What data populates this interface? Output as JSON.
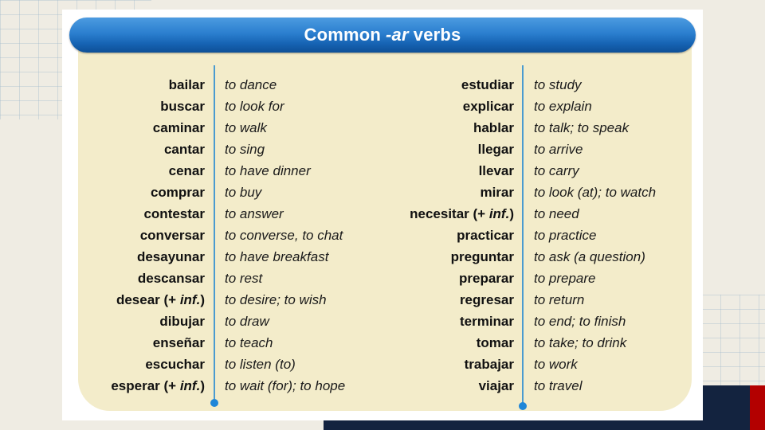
{
  "title": {
    "prefix": "Common",
    "emphasis": "-ar",
    "suffix": "verbs"
  },
  "colors": {
    "title_bar": "#2b7fcf",
    "panel": "#f3ecca",
    "divider": "#4a9bd0",
    "navy_accent": "#13233f",
    "red_accent": "#b30000"
  },
  "left_column": [
    {
      "verb": "bailar",
      "note": "",
      "meaning": "to dance"
    },
    {
      "verb": "buscar",
      "note": "",
      "meaning": "to look for"
    },
    {
      "verb": "caminar",
      "note": "",
      "meaning": "to walk"
    },
    {
      "verb": "cantar",
      "note": "",
      "meaning": "to sing"
    },
    {
      "verb": "cenar",
      "note": "",
      "meaning": "to have dinner"
    },
    {
      "verb": "comprar",
      "note": "",
      "meaning": "to buy"
    },
    {
      "verb": "contestar",
      "note": "",
      "meaning": "to answer"
    },
    {
      "verb": "conversar",
      "note": "",
      "meaning": "to converse, to chat"
    },
    {
      "verb": "desayunar",
      "note": "",
      "meaning": "to have breakfast"
    },
    {
      "verb": "descansar",
      "note": "",
      "meaning": "to rest"
    },
    {
      "verb": "desear (+ ",
      "note": "inf.",
      "close": ")",
      "meaning": "to desire; to wish"
    },
    {
      "verb": "dibujar",
      "note": "",
      "meaning": "to draw"
    },
    {
      "verb": "enseñar",
      "note": "",
      "meaning": "to teach"
    },
    {
      "verb": "escuchar",
      "note": "",
      "meaning": "to listen (to)"
    },
    {
      "verb": "esperar (+ ",
      "note": "inf.",
      "close": ")",
      "meaning": "to wait (for); to hope"
    }
  ],
  "right_column": [
    {
      "verb": "estudiar",
      "note": "",
      "meaning": "to study"
    },
    {
      "verb": "explicar",
      "note": "",
      "meaning": "to explain"
    },
    {
      "verb": "hablar",
      "note": "",
      "meaning": "to talk; to speak"
    },
    {
      "verb": "llegar",
      "note": "",
      "meaning": "to arrive"
    },
    {
      "verb": "llevar",
      "note": "",
      "meaning": "to carry"
    },
    {
      "verb": "mirar",
      "note": "",
      "meaning": "to look (at); to watch"
    },
    {
      "verb": "necesitar (+ ",
      "note": "inf.",
      "close": ")",
      "meaning": "to need"
    },
    {
      "verb": "practicar",
      "note": "",
      "meaning": "to practice"
    },
    {
      "verb": "preguntar",
      "note": "",
      "meaning": "to ask (a question)"
    },
    {
      "verb": "preparar",
      "note": "",
      "meaning": "to prepare"
    },
    {
      "verb": "regresar",
      "note": "",
      "meaning": "to return"
    },
    {
      "verb": "terminar",
      "note": "",
      "meaning": "to end; to finish"
    },
    {
      "verb": "tomar",
      "note": "",
      "meaning": "to take; to drink"
    },
    {
      "verb": "trabajar",
      "note": "",
      "meaning": "to work"
    },
    {
      "verb": "viajar",
      "note": "",
      "meaning": "to travel"
    }
  ]
}
